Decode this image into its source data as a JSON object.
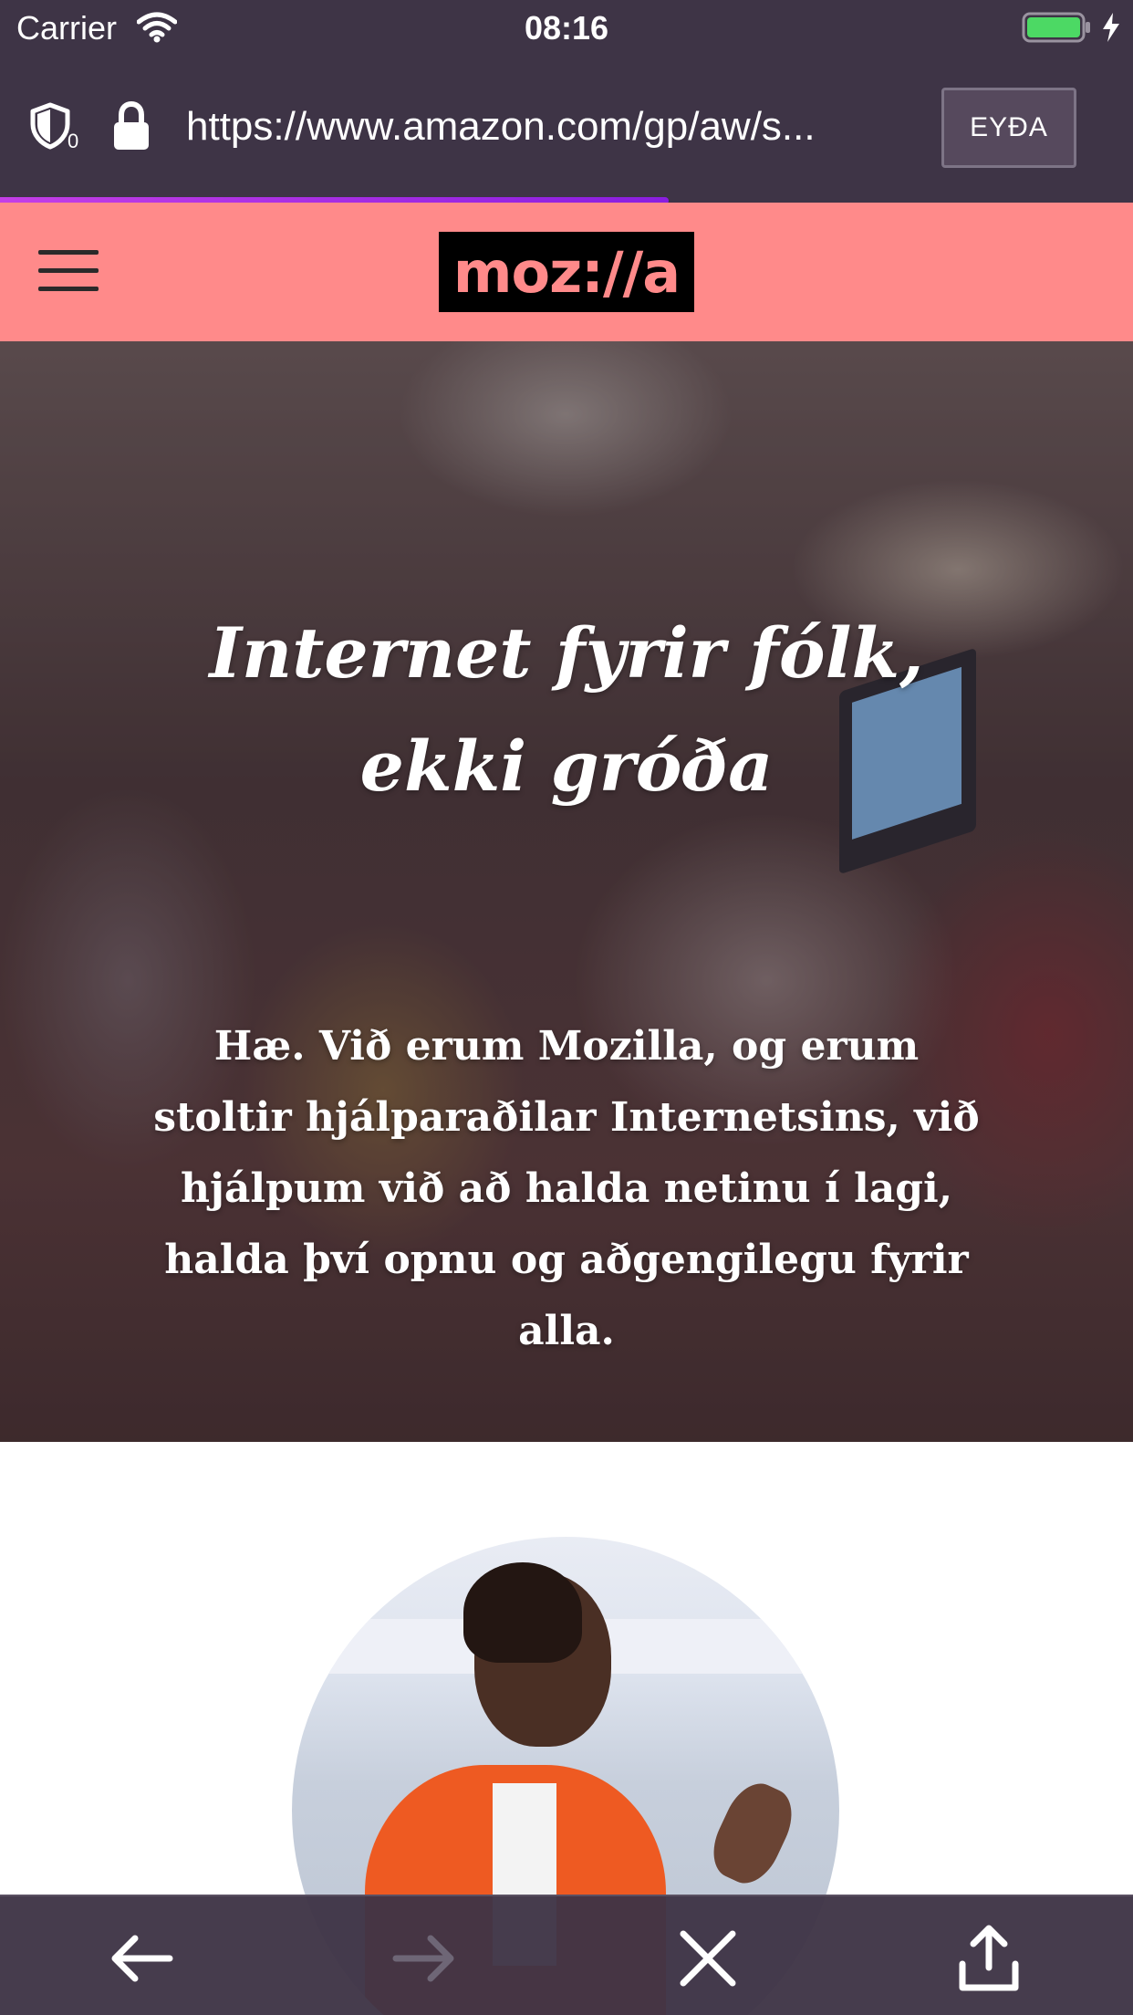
{
  "status_bar": {
    "carrier": "Carrier",
    "time": "08:16",
    "battery_color": "#4cd964"
  },
  "browser": {
    "tracker_count": "0",
    "url": "https://www.amazon.com/gp/aw/s...",
    "erase_label": "EYÐA",
    "load_progress": 0.59,
    "progress_color": "#b030e0"
  },
  "site": {
    "header_color": "#ff8a8a",
    "logo_text": "moz://a",
    "hero_title": "Internet fyrir fólk,\nekki gróða",
    "hero_text": "Hæ. Við erum Mozilla, og erum stoltir hjálparaðilar Internetsins, við hjálpum við að halda netinu í lagi, halda því opnu og aðgengilegu fyrir alla."
  },
  "toolbar": {
    "back_enabled": true,
    "forward_enabled": false
  }
}
